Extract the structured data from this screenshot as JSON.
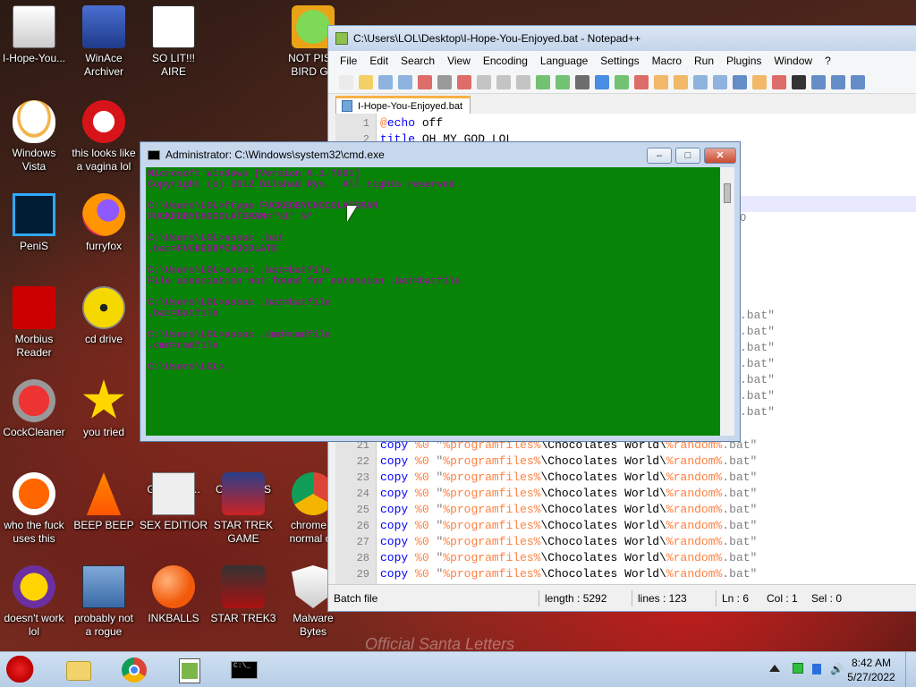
{
  "desktop": {
    "icons": [
      {
        "label": "I-Hope-You...",
        "icon": "bat-file-icon"
      },
      {
        "label": "WinAce Archiver",
        "icon": "archiver-icon"
      },
      {
        "label": "SO LIT!!! AIRE",
        "icon": "solitaire-icon"
      },
      {
        "label": "NOT PISS BIRD GA",
        "icon": "bad-piggies-icon"
      },
      {
        "label": "Windows Vista",
        "icon": "egg-icon"
      },
      {
        "label": "this looks like a vagina lol",
        "icon": "opera-icon"
      },
      {
        "label": "PeniS",
        "icon": "photoshop-icon"
      },
      {
        "label": "furryfox",
        "icon": "firefox-icon"
      },
      {
        "label": "Morbius Reader",
        "icon": "pdf-reader-icon"
      },
      {
        "label": "cd drive",
        "icon": "cd-drive-icon"
      },
      {
        "label": "CockCleaner",
        "icon": "ccleaner-icon"
      },
      {
        "label": "you tried",
        "icon": "star-icon"
      },
      {
        "label": "GADGET...",
        "icon": "gadget-icon"
      },
      {
        "label": "CHICKENS I...",
        "icon": "chickens-icon"
      },
      {
        "label": "who the fuck uses this",
        "icon": "lightning-icon"
      },
      {
        "label": "BEEP BEEP",
        "icon": "vlc-icon"
      },
      {
        "label": "SEX EDITIOR",
        "icon": "hxd-icon"
      },
      {
        "label": "STAR TREK GAME",
        "icon": "star-wars-icon"
      },
      {
        "label": "chrome b normal co",
        "icon": "chrome-icon"
      },
      {
        "label": "doesn't work lol",
        "icon": "yahoo-messenger-icon"
      },
      {
        "label": "probably not a rogue",
        "icon": "settings-monitor-icon"
      },
      {
        "label": "INKBALLS",
        "icon": "inkball-icon"
      },
      {
        "label": "STAR TREK3",
        "icon": "star-wars-3-icon"
      },
      {
        "label": "Malware Bytes",
        "icon": "shield-icon"
      }
    ],
    "wallpaper_text": "Official Santa Letters"
  },
  "notepad": {
    "title": "C:\\Users\\LOL\\Desktop\\I-Hope-You-Enjoyed.bat - Notepad++",
    "menu": [
      "File",
      "Edit",
      "Search",
      "View",
      "Encoding",
      "Language",
      "Settings",
      "Macro",
      "Run",
      "Plugins",
      "Window",
      "?"
    ],
    "tab": "I-Hope-You-Enjoyed.bat",
    "lines_top": [
      {
        "n": "1",
        "parts": [
          [
            "var",
            "@"
          ],
          [
            "kw",
            "echo"
          ],
          [
            "blk",
            " off"
          ]
        ]
      },
      {
        "n": "2",
        "parts": [
          [
            "kw",
            "title"
          ],
          [
            "blk",
            " OH MY GOD LOL"
          ]
        ]
      }
    ],
    "copy_line": {
      "cmd": "copy",
      "arg": "%0",
      "quote": "\"",
      "env": "%programfiles%",
      "path": "\\Chocolates World\\",
      "rand": "%random%",
      "ext": ".bat\""
    },
    "copy_line_numbers": [
      "21",
      "22",
      "23",
      "24",
      "25",
      "26",
      "27",
      "28",
      "29"
    ],
    "partial_tail": ".bat\"",
    "partial_o": "O",
    "status": {
      "type": "Batch file",
      "length": "length : 5292",
      "lines": "lines : 123",
      "ln": "Ln : 6",
      "col": "Col : 1",
      "sel": "Sel : 0"
    }
  },
  "cmd": {
    "title": "Administrator: C:\\Windows\\system32\\cmd.exe",
    "lines": [
      "Microsoft Windows [Version 6.1.7601]",
      "Copyright (c) 2012 Dilshad Rys.  All rights reserved.",
      "",
      "C:\\Users\\LOL>ftype FUCKEDBYCHOCOLATEMAN",
      "FUCKEDBYCHOCOLATEMAN=\"%1\" %*",
      "",
      "C:\\Users\\LOL>assoc .bat",
      ".bat=FUCKEDBYCHOCOLATE",
      "",
      "C:\\Users\\LOL>assoc .bat=batfile",
      "File association not found for extension .bat=batfile",
      "",
      "C:\\Users\\LOL>assoc .bat=batfile",
      ".bat=batfile",
      "",
      "C:\\Users\\LOL>assoc .cmd=cmdfile",
      ".cmd=cmdfile",
      "",
      "C:\\Users\\LOL>_"
    ],
    "colors": {
      "bg": "#078407",
      "fg": "#8b1a8b"
    }
  },
  "taskbar": {
    "apps": [
      "angry-birds-start-icon",
      "explorer-folder-icon",
      "chrome-icon",
      "notepad-plus-plus-icon",
      "cmd-icon"
    ],
    "tray": [
      "show-hidden-icons-arrow",
      "network-status-icon",
      "flag-icon",
      "volume-icon"
    ],
    "time": "8:42 AM",
    "date": "5/27/2022"
  }
}
